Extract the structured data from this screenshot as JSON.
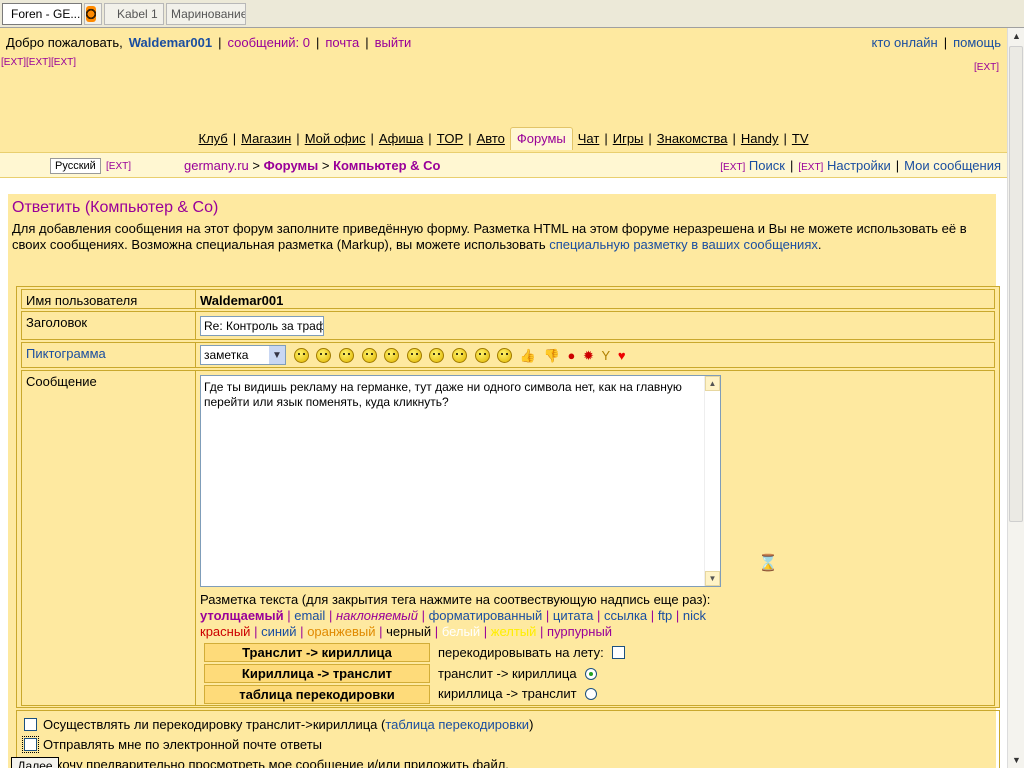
{
  "browser_tabs": [
    {
      "label": "Foren - GE...",
      "active": true,
      "icon": "forum-icon"
    },
    {
      "label": "",
      "active": false,
      "icon": "orange-swirl-icon"
    },
    {
      "label": "Kabel 1",
      "active": false,
      "icon": ""
    },
    {
      "label": "Маринование...",
      "active": false,
      "icon": ""
    }
  ],
  "welcome": {
    "greeting": "Добро пожаловать,",
    "username": "Waldemar001",
    "messages": "сообщений: 0",
    "mail": "почта",
    "logout": "выйти",
    "who_online": "кто онлайн",
    "help": "помощь"
  },
  "ext": {
    "left": "[EXT][EXT][EXT]",
    "right": "[EXT]",
    "tag": "[EXT]"
  },
  "menu": [
    "Клуб",
    "Магазин",
    "Мой офис",
    "Афиша",
    "TOP",
    "Авто",
    "Форумы",
    "Чат",
    "Игры",
    "Знакомства",
    "Handy",
    "TV"
  ],
  "menu_active": "Форумы",
  "crumbbar": {
    "language": "Русский",
    "site": "germany.ru",
    "forums": "Форумы",
    "section": "Компьютер & Co",
    "search": "Поиск",
    "settings": "Настройки",
    "my_messages": "Мои сообщения"
  },
  "form": {
    "title": "Ответить (Компьютер & Co)",
    "intro_text": "Для добавления сообщения на этот форум заполните приведённую форму. Разметка HTML на этом форуме неразрешена и Вы не можете использовать её в своих сообщениях. Возможна специальная разметка (Markup), вы можете использовать ",
    "intro_link": "специальную разметку в ваших сообщениях",
    "intro_end": ".",
    "username_label": "Имя пользователя",
    "username_value": "Waldemar001",
    "subject_label": "Заголовок",
    "subject_value": "Re: Контроль за траф",
    "icon_label": "Пиктограмма",
    "icon_select": "заметка",
    "message_label": "Сообщение",
    "message_text": "Где ты видишь рекламу на германке, тут даже ни одного символа нет, как на главную перейти или язык поменять, куда кликнуть?",
    "markup_hint": "Разметка текста (для закрытия тега нажмите на соотвествующую надпись еще раз):",
    "markup_tags": [
      "утолщаемый",
      "email",
      "наклоняемый",
      "форматированный",
      "цитата",
      "ссылка",
      "ftp",
      "nick"
    ],
    "markup_colors": [
      "красный",
      "синий",
      "оранжевый",
      "черный",
      "белый",
      "желтый",
      "пурпурный"
    ],
    "btn_translit_cyr": "Транслит -> кириллица",
    "btn_cyr_translit": "Кириллица -> транслит",
    "btn_table": "таблица перекодировки",
    "recode_on_fly": "перекодировывать на лету:",
    "translit_to_cyr": "транслит -> кириллица",
    "cyr_to_translit": "кириллица -> транслит",
    "opt1_text": "Осуществлять ли перекодировку транслит->кириллица (",
    "opt1_link": "таблица перекодировки",
    "opt1_end": ")",
    "opt2_text": "Отправлять мне по электронной почте ответы",
    "opt3_text": "Я хочу предварительно просмотреть мое сообщение и/или приложить файл.",
    "next_label": "Далее"
  },
  "colors": {
    "bg_yellow": "#fee9a0",
    "purple_link": "#990099",
    "blue_link": "#1a4ea0",
    "button": "#fedb7a"
  }
}
